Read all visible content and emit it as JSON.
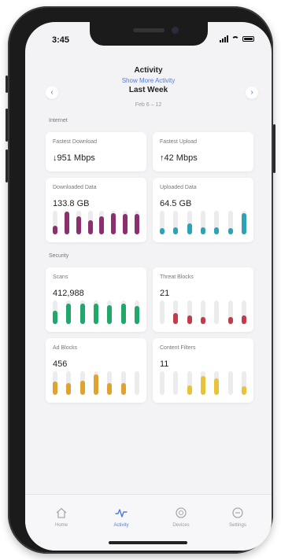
{
  "status_bar": {
    "time": "3:45"
  },
  "header": {
    "title": "Activity",
    "link": "Show More Activity",
    "period": "Last Week",
    "range": "Feb 6 – 12"
  },
  "sections": {
    "internet": "Internet",
    "security": "Security"
  },
  "cards": {
    "fastest_download": {
      "label": "Fastest Download",
      "value": "↓951 Mbps"
    },
    "fastest_upload": {
      "label": "Fastest Upload",
      "value": "↑42 Mbps"
    },
    "downloaded_data": {
      "label": "Downloaded Data",
      "value": "133.8 GB",
      "color": "#8b2f6e",
      "levels": [
        0.35,
        0.95,
        0.75,
        0.6,
        0.75,
        0.9,
        0.85,
        0.85
      ]
    },
    "uploaded_data": {
      "label": "Uploaded Data",
      "value": "64.5 GB",
      "color": "#2aa3b7",
      "levels": [
        0.25,
        0.3,
        0.45,
        0.3,
        0.3,
        0.25,
        0.9
      ]
    },
    "scans": {
      "label": "Scans",
      "value": "412,988",
      "color": "#1fa86a",
      "levels": [
        0.55,
        0.85,
        0.85,
        0.85,
        0.8,
        0.85,
        0.75
      ]
    },
    "threat_blocks": {
      "label": "Threat Blocks",
      "value": "21",
      "color": "#c23b4a",
      "levels": [
        0,
        0.45,
        0.35,
        0.3,
        0,
        0.3,
        0.35
      ]
    },
    "ad_blocks": {
      "label": "Ad Blocks",
      "value": "456",
      "color": "#e0a230",
      "levels": [
        0.55,
        0.5,
        0.6,
        0.85,
        0.5,
        0.5,
        0
      ]
    },
    "content_filters": {
      "label": "Content Filters",
      "value": "11",
      "color": "#e8c33a",
      "levels": [
        0,
        0,
        0.4,
        0.8,
        0.7,
        0,
        0.35
      ]
    }
  },
  "tabs": [
    {
      "label": "Home",
      "icon": "home-icon"
    },
    {
      "label": "Activity",
      "icon": "activity-icon",
      "active": true
    },
    {
      "label": "Devices",
      "icon": "devices-icon"
    },
    {
      "label": "Settings",
      "icon": "settings-icon"
    }
  ],
  "colors": {
    "accent": "#4f7ae0"
  }
}
